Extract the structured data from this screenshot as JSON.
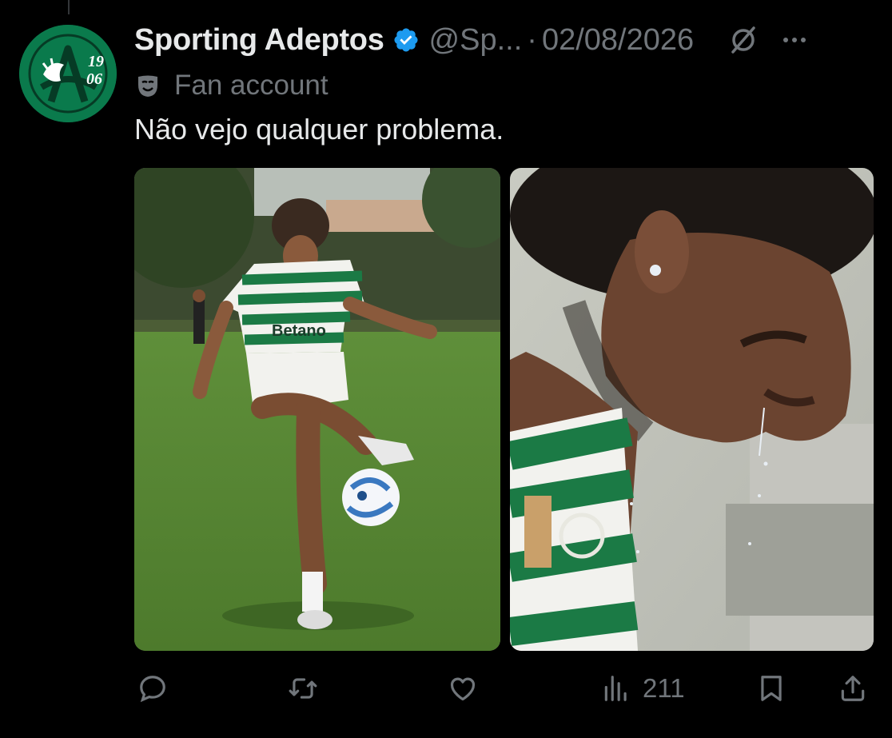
{
  "tweet": {
    "display_name": "Sporting Adeptos",
    "handle": "@Sp...",
    "separator": "·",
    "date": "02/08/2026",
    "label": "Fan account",
    "text": "Não vejo qualquer problema.",
    "avatar": {
      "year_top": "19",
      "year_bottom": "06"
    },
    "media": [
      {
        "description_name": "player-juggling-ball-photo",
        "sponsor_text": "Betano"
      },
      {
        "description_name": "player-closeup-photo"
      }
    ],
    "actions": {
      "reply_icon": "speech-bubble-icon",
      "retweet_icon": "retweet-icon",
      "like_icon": "heart-icon",
      "views_icon": "bar-chart-icon",
      "views_count": "211",
      "bookmark_icon": "bookmark-icon",
      "share_icon": "share-icon"
    }
  },
  "colors": {
    "background": "#000000",
    "text_primary": "#e7e9ea",
    "text_secondary": "#71767b",
    "verified_blue": "#1d9bf0",
    "avatar_green": "#0a7a4c"
  }
}
